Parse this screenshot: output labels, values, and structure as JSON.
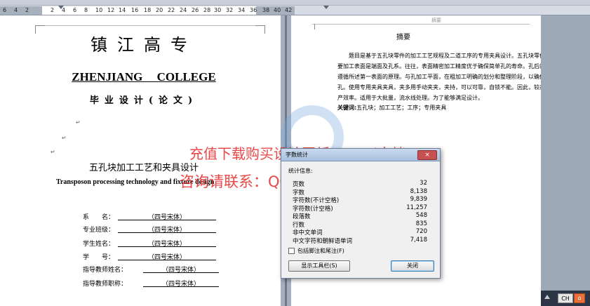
{
  "ruler": {
    "numbers": [
      "6",
      "4",
      "2",
      "2",
      "4",
      "6",
      "8",
      "10",
      "12",
      "14",
      "16",
      "18",
      "20",
      "22",
      "24",
      "26",
      "28",
      "30",
      "32",
      "34",
      "36",
      "38",
      "40",
      "42"
    ]
  },
  "cover": {
    "title_cn": "镇江高专",
    "title_en": "ZHENJIANG COLLEGE",
    "subtitle": "毕业设计(论文)",
    "thesis_cn": "五孔块加工工艺和夹具设计",
    "thesis_en": "Transposon processing technology and fixture design",
    "fields": [
      {
        "label": "系　　名：",
        "value": "（四号宋体）"
      },
      {
        "label": "专业班级：",
        "value": "（四号宋体）"
      },
      {
        "label": "学生姓名：",
        "value": "（四号宋体）"
      },
      {
        "label": "学　　号：",
        "value": "（四号宋体）"
      },
      {
        "label": "指导教师姓名：",
        "value": "（四号宋体）"
      },
      {
        "label": "指导教师职称：",
        "value": "（四号宋体）"
      }
    ]
  },
  "abstract": {
    "header": "摘要",
    "title": "摘要",
    "body": "题目是基于五孔块零件的加工工艺规程及二道工序的专用夹具设计。五孔块零件的主要加工表面是端面及孔系。往往，表面精密加工精度优于确保简单孔的寿命。孔后的设计遵循所述第一表面的原理。与孔加工平面，在粗加工明确的划分和整理阶段，以确保精确孔。使用专用夹具夹具，夹多用手动夹夹，夹持，可以可靠，自锁不能。因此，较高的生产效率。适用于大批量，流水线处理。为了能够满足设计。",
    "keywords_label": "关键词:",
    "keywords": "五孔块；加工工艺；工序；专用夹具"
  },
  "watermark": {
    "line1": "充值下载购买设计图纸+Word文档",
    "line2": "咨询请联系：QQ 197216396"
  },
  "dialog": {
    "title": "字数统计",
    "close_glyph": "×",
    "stats_label": "统计信息:",
    "stats": [
      {
        "name": "页数",
        "value": "32"
      },
      {
        "name": "字数",
        "value": "8,138"
      },
      {
        "name": "字符数(不计空格)",
        "value": "9,839"
      },
      {
        "name": "字符数(计空格)",
        "value": "11,257"
      },
      {
        "name": "段落数",
        "value": "548"
      },
      {
        "name": "行数",
        "value": "835"
      },
      {
        "name": "非中文单词",
        "value": "720"
      },
      {
        "name": "中文字符和朝鲜语单词",
        "value": "7,418"
      }
    ],
    "checkbox_label": "包括脚注和尾注(F)",
    "toolbar_button": "显示工具栏(S)",
    "close_button": "关闭"
  },
  "statusbar": {
    "ime": "CH"
  }
}
